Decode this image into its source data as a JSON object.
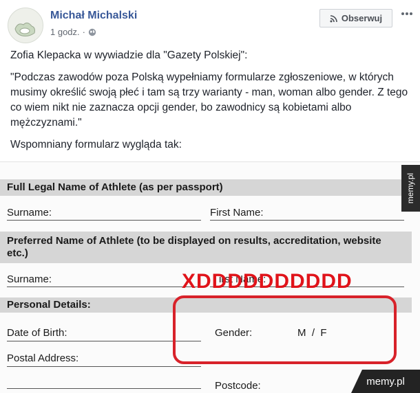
{
  "post": {
    "author_name": "Michał Michalski",
    "timestamp": "1 godz.",
    "separator": "·",
    "privacy_icon": "globe-icon",
    "follow_button": {
      "label": "Obserwuj",
      "icon": "rss-icon"
    },
    "more_icon": "more-options-icon",
    "paragraphs": [
      "Zofia Klepacka w wywiadzie dla \"Gazety Polskiej\":",
      "\"Podczas zawodów poza Polską wypełniamy formularze zgłoszeniowe, w których musimy określić swoją płeć i tam są trzy warianty - man, woman albo gender. Z tego co wiem nikt nie zaznacza opcji gender, bo zawodnicy są kobietami albo mężczyznami.\"",
      "Wspomniany formularz wygląda tak:"
    ]
  },
  "form": {
    "section1_title": "Full Legal Name of Athlete (as per passport)",
    "surname_label": "Surname:",
    "first_name_label": "First Name:",
    "section2_title": "Preferred Name of Athlete (to be displayed on results, accreditation, website etc.)",
    "surname2_label": "Surname:",
    "first_name2_label_partial": "irst Name:",
    "overlay_text": "XDDDDDDDDDD",
    "section3_title": "Personal Details:",
    "dob_label": "Date of Birth:",
    "gender_label": "Gender:",
    "gender_options": "M  /  F",
    "postal_address_label": "Postal Address:",
    "postcode_label": "Postcode:"
  },
  "watermarks": {
    "side": "memy.pl",
    "corner": "memy.pl"
  },
  "colors": {
    "link_blue": "#385898",
    "annotation_red": "#d8222a",
    "band_gray": "#d6d6d6"
  }
}
